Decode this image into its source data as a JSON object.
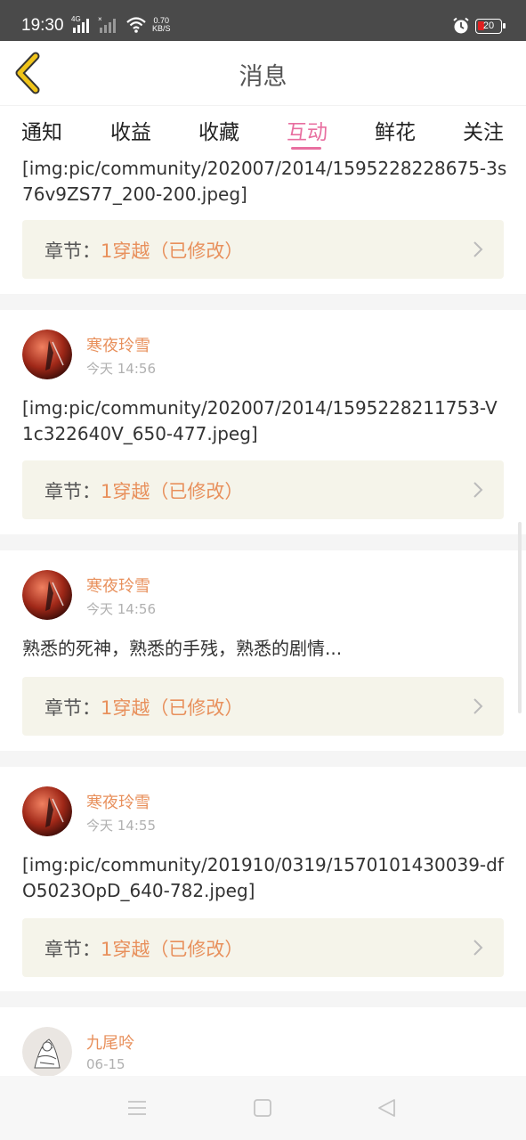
{
  "status": {
    "time": "19:30",
    "signal1_label": "4G",
    "signal2_label": "×",
    "net_speed_value": "0.70",
    "net_speed_unit": "KB/S",
    "battery": "20"
  },
  "header": {
    "title": "消息"
  },
  "tabs": [
    {
      "label": "通知",
      "active": false
    },
    {
      "label": "收益",
      "active": false
    },
    {
      "label": "收藏",
      "active": false
    },
    {
      "label": "互动",
      "active": true
    },
    {
      "label": "鲜花",
      "active": false
    },
    {
      "label": "关注",
      "active": false
    }
  ],
  "feed": [
    {
      "text": "[img:pic/community/202007/2014/1595228228675-3s76v9ZS77_200-200.jpeg]",
      "chapter_prefix": "章节：",
      "chapter_name": "1穿越（已修改）"
    },
    {
      "user": "寒夜玲雪",
      "time": "今天 14:56",
      "text": "[img:pic/community/202007/2014/1595228211753-V1c322640V_650-477.jpeg]",
      "chapter_prefix": "章节：",
      "chapter_name": "1穿越（已修改）"
    },
    {
      "user": "寒夜玲雪",
      "time": "今天 14:56",
      "text": "熟悉的死神，熟悉的手残，熟悉的剧情...",
      "chapter_prefix": "章节：",
      "chapter_name": "1穿越（已修改）"
    },
    {
      "user": "寒夜玲雪",
      "time": "今天 14:55",
      "text": "[img:pic/community/201910/0319/1570101430039-dfO5023OpD_640-782.jpeg]",
      "chapter_prefix": "章节：",
      "chapter_name": "1穿越（已修改）"
    },
    {
      "user": "九尾呤",
      "time": "06-15"
    }
  ],
  "colors": {
    "accent": "#e86fa0",
    "username": "#e8905c",
    "chapter_bg": "#f5f4ea",
    "back_arrow": "#f0c419"
  }
}
